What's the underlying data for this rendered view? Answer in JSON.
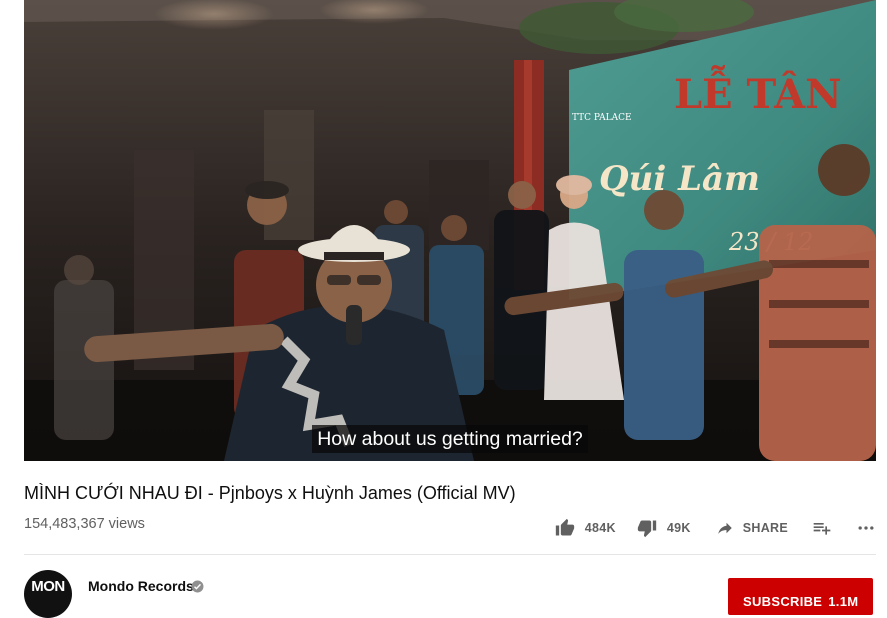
{
  "player": {
    "caption": "How about us getting married?",
    "stage_screen": {
      "logo_name": "TTC PALACE",
      "heading": "LỄ TÂN",
      "names": "Qúi Lâm",
      "date": "23 / 12"
    }
  },
  "video": {
    "title": "MÌNH CƯỚI NHAU ĐI - Pjnboys x Huỳnh James (Official MV)",
    "views": "154,483,367 views"
  },
  "actions": {
    "like_count": "484K",
    "dislike_count": "49K",
    "share_label": "SHARE",
    "icons": [
      "thumb-up-icon",
      "thumb-down-icon",
      "share-icon",
      "playlist-add-icon",
      "more-icon"
    ]
  },
  "owner": {
    "avatar_text": "MON",
    "channel_name": "Mondo Records",
    "verified": true
  },
  "subscribe": {
    "label": "SUBSCRIBE",
    "count": "1.1M"
  },
  "colors": {
    "subscribe_red": "#cc0000",
    "secondary_text": "#606060",
    "primary_text": "#0f0f0f",
    "screen_teal": "#3f8a80",
    "screen_text_red": "#c0392b"
  }
}
